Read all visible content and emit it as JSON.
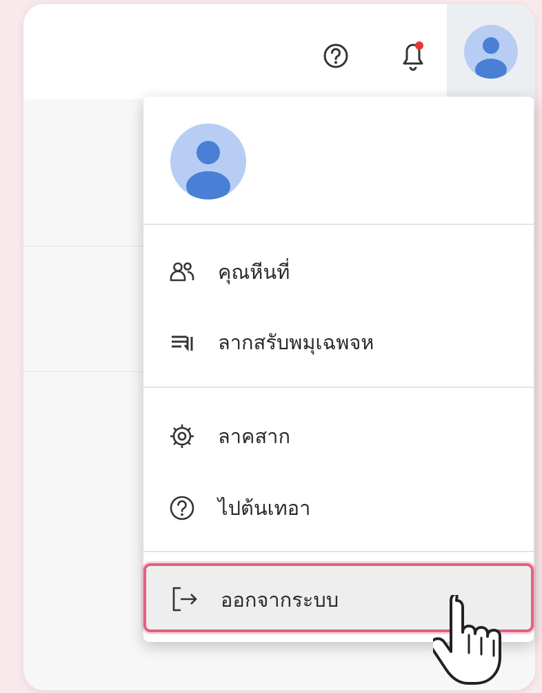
{
  "header": {
    "help_icon": "help-circle-icon",
    "notifications_icon": "bell-icon",
    "notification_badge_color": "#e53935",
    "avatar_icon": "user-avatar-icon"
  },
  "account": {
    "name": "",
    "email": "",
    "avatar_color": "#4a7fd6",
    "avatar_bg": "#b7cdf3"
  },
  "menu": {
    "items": [
      {
        "icon": "people-icon",
        "label": "คุณหีนที่"
      },
      {
        "icon": "queue-icon",
        "label": "ลากสรับพมุเฉพจห"
      },
      {
        "icon": "settings-gear-icon",
        "label": "ลาคสาก"
      },
      {
        "icon": "help-circle-icon",
        "label": "ไปต้นเทอา"
      }
    ],
    "logout": {
      "icon": "logout-arrow-icon",
      "label": "ออกจากระบบ",
      "highlight_color": "#e2607f"
    }
  },
  "cursor": {
    "icon": "hand-pointer-cursor"
  }
}
